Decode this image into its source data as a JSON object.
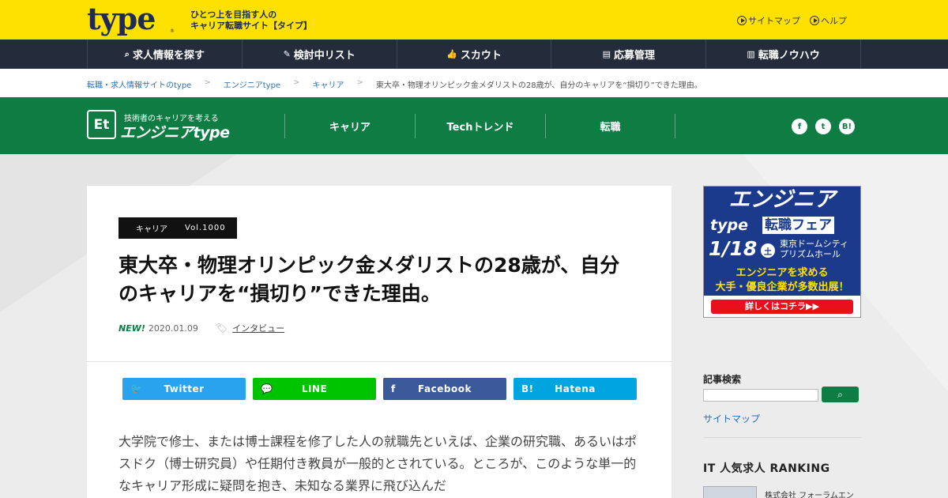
{
  "header": {
    "logo": "type",
    "logo_mark": "®",
    "tagline_line1": "ひとつ上を目指す人の",
    "tagline_line2": "キャリア転職サイト【タイプ】",
    "links": [
      {
        "label": "サイトマップ"
      },
      {
        "label": "ヘルプ"
      }
    ]
  },
  "mainnav": [
    {
      "icon": "⌕",
      "label": "求人情報を探す"
    },
    {
      "icon": "✎",
      "label": "検討中リスト"
    },
    {
      "icon": "👍",
      "label": "スカウト"
    },
    {
      "icon": "▤",
      "label": "応募管理"
    },
    {
      "icon": "▥",
      "label": "転職ノウハウ"
    }
  ],
  "breadcrumb": {
    "items": [
      "転職・求人情報サイトのtype",
      "エンジニアtype",
      "キャリア"
    ],
    "separator": ">",
    "current": "東大卒・物理オリンピック金メダリストの28歳が、自分のキャリアを“損切り”できた理由。"
  },
  "etbar": {
    "logo_mark": "Et",
    "subtitle": "技術者のキャリアを考える",
    "name": "エンジニアtype",
    "nav": [
      "キャリア",
      "Techトレンド",
      "転職"
    ],
    "social": [
      "f",
      "t",
      "B!"
    ]
  },
  "article": {
    "category": "キャリア",
    "volume": "Vol.1000",
    "title": "東大卒・物理オリンピック金メダリストの28歳が、自分のキャリアを“損切り”できた理由。",
    "new_label": "NEW!",
    "date": "2020.01.09",
    "tag": "インタビュー",
    "share": [
      {
        "icon": "🐦",
        "label": "Twitter"
      },
      {
        "icon": "💬",
        "label": "LINE"
      },
      {
        "icon": "f",
        "label": "Facebook"
      },
      {
        "icon": "B!",
        "label": "Hatena"
      }
    ],
    "body": "大学院で修士、または博士課程を修了した人の就職先といえば、企業の研究職、あるいはポスドク（博士研究員）や任期付き教員が一般的とされている。ところが、このような単一的なキャリア形成に疑問を抱き、未知なる業界に飛び込んだ"
  },
  "sidebar": {
    "ad": {
      "title": "エンジニア",
      "type": "type",
      "fair": "転職フェア",
      "date": "1/18",
      "day": "土",
      "venue_line1": "東京ドームシティ",
      "venue_line2": "プリズムホール",
      "line1": "エンジニアを求める",
      "line2": "大手・優良企業が多数出展！",
      "cta": "詳しくはコチラ▶▶"
    },
    "search_label": "記事検索",
    "search_placeholder": "",
    "search_button_icon": "⌕",
    "sitemap": "サイトマップ",
    "ranking_title": "IT 人気求人 RANKING",
    "ranking_company": "株式会社 フォーラムエン"
  },
  "colors": {
    "yellow": "#ffe100",
    "navy": "#242b3b",
    "green": "#0f7c44",
    "twitter": "#2aa3ef",
    "line": "#00c300",
    "facebook": "#3b5998",
    "hatena": "#00a4de"
  }
}
